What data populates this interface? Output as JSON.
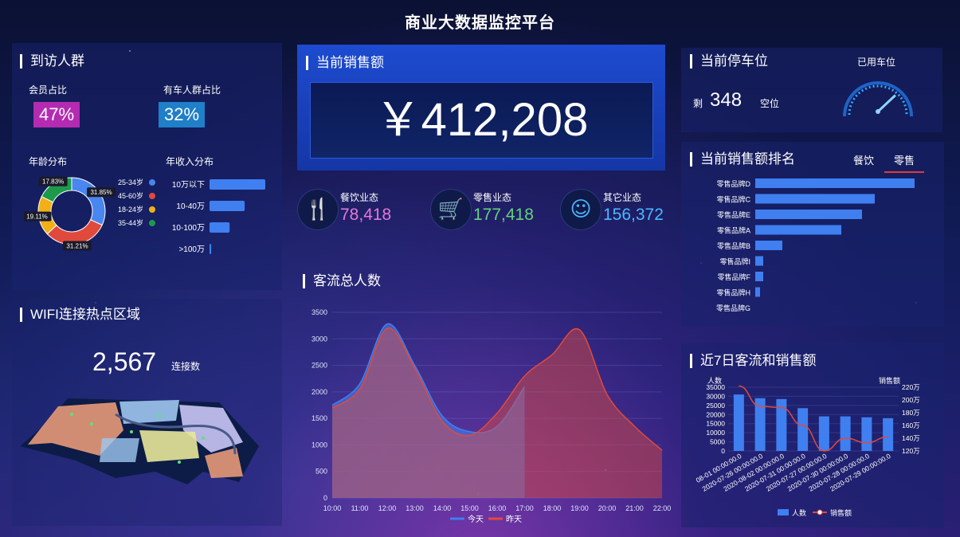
{
  "header": {
    "title": "商业大数据监控平台"
  },
  "visitors": {
    "title": "到访人群",
    "member_label": "会员占比",
    "member_pct": "47%",
    "car_label": "有车人群占比",
    "car_pct": "32%",
    "age_title": "年龄分布",
    "income_title": "年收入分布",
    "age_slices": [
      {
        "label": "25-34岁",
        "pct": 31.85,
        "pct_text": "31.85%",
        "color": "#4a86f0"
      },
      {
        "label": "45-60岁",
        "pct": 31.21,
        "pct_text": "31.21%",
        "color": "#e04a3c"
      },
      {
        "label": "18-24岁",
        "pct": 19.11,
        "pct_text": "19.11%",
        "color": "#f2b016"
      },
      {
        "label": "35-44岁",
        "pct": 17.83,
        "pct_text": "17.83%",
        "color": "#1c9a4a"
      }
    ],
    "income": [
      {
        "label": "10万以下",
        "value": 100
      },
      {
        "label": "10-40万",
        "value": 63
      },
      {
        "label": "10-100万",
        "value": 36
      },
      {
        "label": ">100万",
        "value": 3
      }
    ]
  },
  "wifi": {
    "title": "WIFI连接热点区域",
    "count": "2,567",
    "count_label": "连接数"
  },
  "sales": {
    "title": "当前销售额",
    "amount": "￥412,208",
    "categories": [
      {
        "label": "餐饮业态",
        "value": "78,418",
        "icon": "fork-knife-icon",
        "color": "#e07ad8"
      },
      {
        "label": "零售业态",
        "value": "177,418",
        "icon": "cart-icon",
        "color": "#5fd47a"
      },
      {
        "label": "其它业态",
        "value": "156,372",
        "icon": "smiley-icon",
        "color": "#4cb8ff"
      }
    ]
  },
  "flow": {
    "title": "客流总人数",
    "legend_today": "今天",
    "legend_yesterday": "昨天"
  },
  "parking": {
    "title": "当前停车位",
    "remaining_label": "剩",
    "remaining": "348",
    "unit": "空位",
    "gauge_title": "已用车位",
    "gauge_level": 0.82
  },
  "ranking": {
    "title": "当前销售额排名",
    "tab_food": "餐饮",
    "tab_retail": "零售",
    "items": [
      {
        "label": "零售品牌D",
        "value": 100
      },
      {
        "label": "零售品牌C",
        "value": 75
      },
      {
        "label": "零售品牌E",
        "value": 67
      },
      {
        "label": "零售品牌A",
        "value": 54
      },
      {
        "label": "零售品牌B",
        "value": 17
      },
      {
        "label": "零售品牌I",
        "value": 5
      },
      {
        "label": "零售品牌F",
        "value": 5
      },
      {
        "label": "零售品牌H",
        "value": 3
      },
      {
        "label": "零售品牌G",
        "value": 0
      }
    ]
  },
  "week": {
    "title": "近7日客流和销售额",
    "left_axis_title": "人数",
    "right_axis_title": "销售额",
    "legend_people": "人数",
    "legend_sales": "销售额"
  },
  "chart_data": [
    {
      "type": "area",
      "title": "客流总人数",
      "categories": [
        "10:00",
        "11:00",
        "12:00",
        "13:00",
        "14:00",
        "15:00",
        "16:00",
        "17:00",
        "18:00",
        "19:00",
        "20:00",
        "21:00",
        "22:00"
      ],
      "ylim": [
        0,
        3500
      ],
      "yticks": [
        0,
        500,
        1000,
        1500,
        2000,
        2500,
        3000,
        3500
      ],
      "series": [
        {
          "name": "今天",
          "color": "#3f7ff0",
          "values": [
            1750,
            2150,
            3280,
            2500,
            1550,
            1250,
            1350,
            2100,
            null,
            null,
            null,
            null,
            null
          ]
        },
        {
          "name": "昨天",
          "color": "#e04a3c",
          "values": [
            1700,
            2050,
            3200,
            2450,
            1450,
            1180,
            1600,
            2300,
            2700,
            3170,
            1950,
            1350,
            900
          ]
        }
      ]
    },
    {
      "type": "bar",
      "title": "近7日客流和销售额",
      "categories": [
        "08-01 00:00:00.0",
        "2020-07-26 00:00:00.0",
        "2020-08-02 00:00:00.0",
        "2020-07-31 00:00:00.0",
        "2020-07-27 00:00:00.0",
        "2020-07-30 00:00:00.0",
        "2020-07-28 00:00:00.0",
        "2020-07-29 00:00:00.0"
      ],
      "left_ylim": [
        0,
        35000
      ],
      "left_ticks": [
        "0",
        "5000",
        "10000",
        "15000",
        "20000",
        "25000",
        "30000",
        "35000"
      ],
      "right_ylim": [
        120,
        220
      ],
      "right_ticks": [
        "120万",
        "140万",
        "160万",
        "180万",
        "200万",
        "220万"
      ],
      "series": [
        {
          "name": "人数",
          "type": "bar",
          "color": "#3f7ff0",
          "values": [
            31000,
            29000,
            28500,
            23500,
            19000,
            19000,
            18500,
            18000
          ]
        },
        {
          "name": "销售额",
          "type": "line",
          "color": "#e04a3c",
          "values": [
            222,
            190,
            188,
            160,
            120,
            140,
            133,
            142
          ]
        }
      ]
    }
  ]
}
